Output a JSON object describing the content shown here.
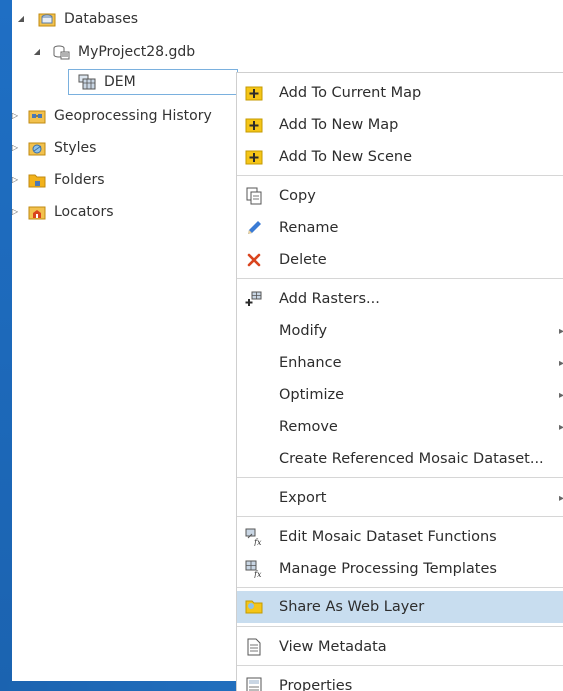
{
  "tree": {
    "databases": "Databases",
    "gdb": "MyProject28.gdb",
    "dem": "DEM",
    "geoprocessing": "Geoprocessing History",
    "styles": "Styles",
    "folders": "Folders",
    "locators": "Locators"
  },
  "menu": {
    "add_current_map": "Add To Current Map",
    "add_new_map": "Add To New Map",
    "add_new_scene": "Add To New Scene",
    "copy": "Copy",
    "rename": "Rename",
    "delete": "Delete",
    "add_rasters": "Add Rasters...",
    "modify": "Modify",
    "enhance": "Enhance",
    "optimize": "Optimize",
    "remove": "Remove",
    "create_ref": "Create Referenced Mosaic Dataset...",
    "export": "Export",
    "edit_functions": "Edit Mosaic Dataset Functions",
    "manage_templates": "Manage Processing Templates",
    "share_web": "Share As Web Layer",
    "view_metadata": "View Metadata",
    "properties": "Properties"
  },
  "colors": {
    "frame": "#1b63b0",
    "highlight": "#c8ddef",
    "selection_border": "#7ab0de",
    "folder": "#f0b400",
    "delete": "#d9441e"
  }
}
